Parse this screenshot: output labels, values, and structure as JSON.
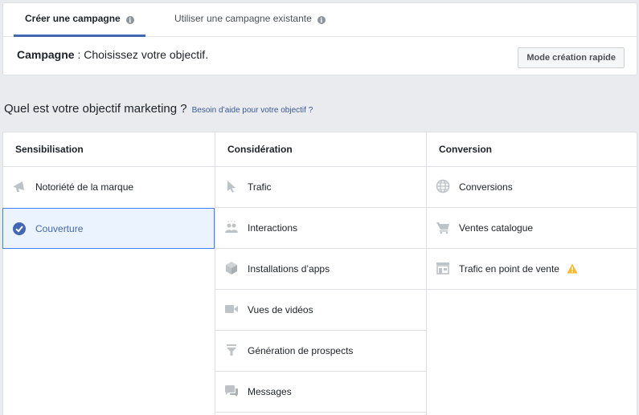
{
  "tabs": [
    {
      "label": "Créer une campagne",
      "active": true
    },
    {
      "label": "Utiliser une campagne existante",
      "active": false
    }
  ],
  "info_icon_glyph": "i",
  "campaign": {
    "label": "Campagne",
    "text": " : Choisissez votre objectif."
  },
  "quick_mode_button": "Mode création rapide",
  "question": {
    "text": "Quel est votre objectif marketing ?",
    "help_link": "Besoin d’aide pour votre objectif ?"
  },
  "columns": [
    {
      "title": "Sensibilisation",
      "items": [
        {
          "label": "Notoriété de la marque",
          "icon": "megaphone-icon"
        },
        {
          "label": "Couverture",
          "icon": "check-circle-icon",
          "selected": true
        }
      ]
    },
    {
      "title": "Considération",
      "items": [
        {
          "label": "Trafic",
          "icon": "cursor-icon"
        },
        {
          "label": "Interactions",
          "icon": "people-icon"
        },
        {
          "label": "Installations d’apps",
          "icon": "box-icon"
        },
        {
          "label": "Vues de vidéos",
          "icon": "video-camera-icon"
        },
        {
          "label": "Génération de prospects",
          "icon": "funnel-icon"
        },
        {
          "label": "Messages",
          "icon": "chat-bubbles-icon"
        }
      ]
    },
    {
      "title": "Conversion",
      "items": [
        {
          "label": "Conversions",
          "icon": "globe-icon"
        },
        {
          "label": "Ventes catalogue",
          "icon": "shopping-cart-icon"
        },
        {
          "label": "Trafic en point de vente",
          "icon": "store-icon",
          "warning": true
        }
      ]
    }
  ],
  "colors": {
    "accent": "#4267b2",
    "selected_bg": "#ebf3fe",
    "selected_border": "#4080ff",
    "icon_gray": "#bec3c9",
    "warning": "#f7b928"
  }
}
